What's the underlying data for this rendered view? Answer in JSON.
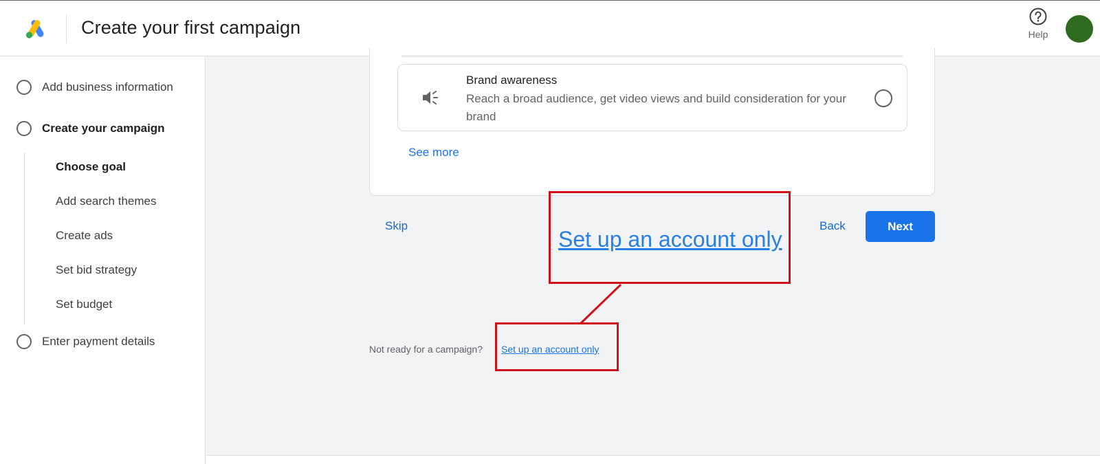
{
  "header": {
    "title": "Create your first campaign",
    "help_label": "Help",
    "logo_icon": "google-ads-logo",
    "help_icon": "help-circle-icon"
  },
  "sidebar": {
    "steps": [
      {
        "label": "Add business information"
      },
      {
        "label": "Create your campaign"
      },
      {
        "label": "Enter payment details"
      }
    ],
    "substeps": [
      {
        "label": "Choose goal"
      },
      {
        "label": "Add search themes"
      },
      {
        "label": "Create ads"
      },
      {
        "label": "Set bid strategy"
      },
      {
        "label": "Set budget"
      }
    ]
  },
  "goal_option": {
    "icon": "megaphone-icon",
    "title": "Brand awareness",
    "description": "Reach a broad audience, get video views and build consideration for your brand"
  },
  "see_more": "See more",
  "actions": {
    "skip": "Skip",
    "back": "Back",
    "next": "Next"
  },
  "footer": {
    "not_ready_text": "Not ready for a campaign?",
    "setup_link": "Set up an account only"
  },
  "annotation": {
    "callout_text": "Set up an account only",
    "color": "#d0111a"
  },
  "colors": {
    "accent": "#1a73e8",
    "avatar": "#2e6b1f"
  }
}
